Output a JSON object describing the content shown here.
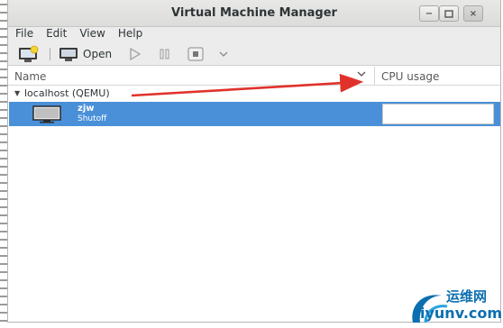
{
  "window": {
    "title": "Virtual Machine Manager",
    "controls": {
      "minimize": "−",
      "maximize": "▫",
      "close": "×"
    }
  },
  "menubar": {
    "items": [
      "File",
      "Edit",
      "View",
      "Help"
    ]
  },
  "toolbar": {
    "new_vm_icon": "new-vm-icon",
    "open_label": "Open",
    "open_icon": "monitor-icon",
    "run_icon": "play-icon",
    "pause_icon": "pause-icon",
    "shutdown_icon": "stop-icon",
    "dropdown_icon": "chevron-down-icon"
  },
  "list": {
    "columns": {
      "name": "Name",
      "cpu": "CPU usage"
    },
    "groups": [
      {
        "label": "localhost (QEMU)",
        "expanded": true,
        "vms": [
          {
            "name": "zjw",
            "state": "Shutoff",
            "selected": true
          }
        ]
      }
    ]
  },
  "annotation": {
    "color": "#e0322b"
  },
  "watermark": {
    "line1": "运维网",
    "line2": "iyunv.com"
  },
  "colors": {
    "selection": "#4a90d9",
    "watermark": "#0c6fb0"
  }
}
